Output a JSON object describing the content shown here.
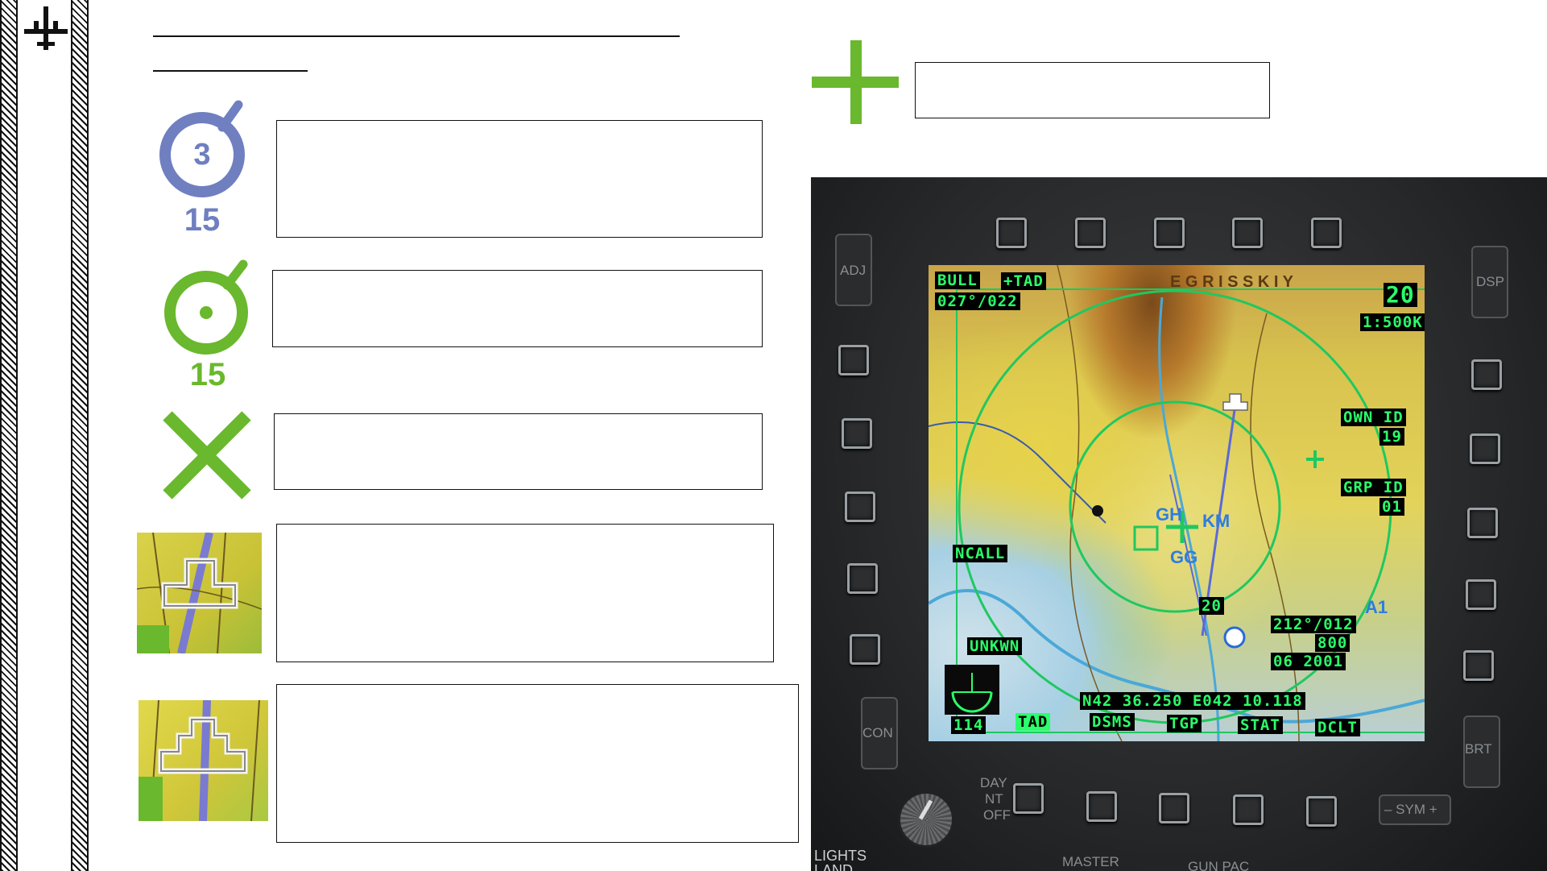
{
  "colors": {
    "accent_green": "#6ab82d",
    "accent_blue": "#6f7fc0",
    "hud_green": "#2bff6a"
  },
  "legend": {
    "blue_symbol": {
      "ring_number": "3",
      "label_number": "15",
      "icon": "blue-circle-marker-icon"
    },
    "green_symbol": {
      "label_number": "15",
      "icon": "green-circle-marker-icon"
    },
    "x_symbol": {
      "icon": "green-x-mark-icon"
    },
    "thumb_1": {
      "icon": "own-aircraft-map-thumbnail"
    },
    "thumb_2": {
      "icon": "flight-group-map-thumbnail"
    },
    "cross_symbol": {
      "icon": "green-cross-icon"
    }
  },
  "mfcd": {
    "top_labels": {
      "bull": "BULL",
      "tad": "+TAD",
      "bearing": "027°/022",
      "range": "20",
      "scale": "1:500K"
    },
    "right_labels": {
      "own_id": "OWN ID",
      "own_id_value": "19",
      "grp_id": "GRP ID",
      "grp_id_value": "01"
    },
    "left_labels": {
      "ncall": "NCALL",
      "unkwn": "UNKWN",
      "hdg_num": "114"
    },
    "bottom_labels": {
      "coords": "N42 36.250 E042 10.118",
      "tad": "TAD",
      "dsms": "DSMS",
      "tgp": "TGP",
      "stat": "STAT",
      "dclt": "DCLT"
    },
    "track_block": {
      "bearing": "212°/012",
      "alt": "800",
      "time": "06 2001"
    },
    "map_text": {
      "region": "E G R I S S K I Y",
      "gh": "GH",
      "km": "KM",
      "gg": "GG",
      "a1": "A1",
      "n20": "20"
    },
    "rockers": {
      "adj": "ADJ",
      "dsp": "DSP",
      "con": "CON",
      "brt": "BRT",
      "sym": "– SYM +"
    },
    "panel": {
      "day": "DAY",
      "nt": "NT",
      "off": "OFF",
      "lights": "LIGHTS",
      "land": "LAND",
      "master": "MASTER",
      "gun_pac": "GUN PAC"
    }
  }
}
